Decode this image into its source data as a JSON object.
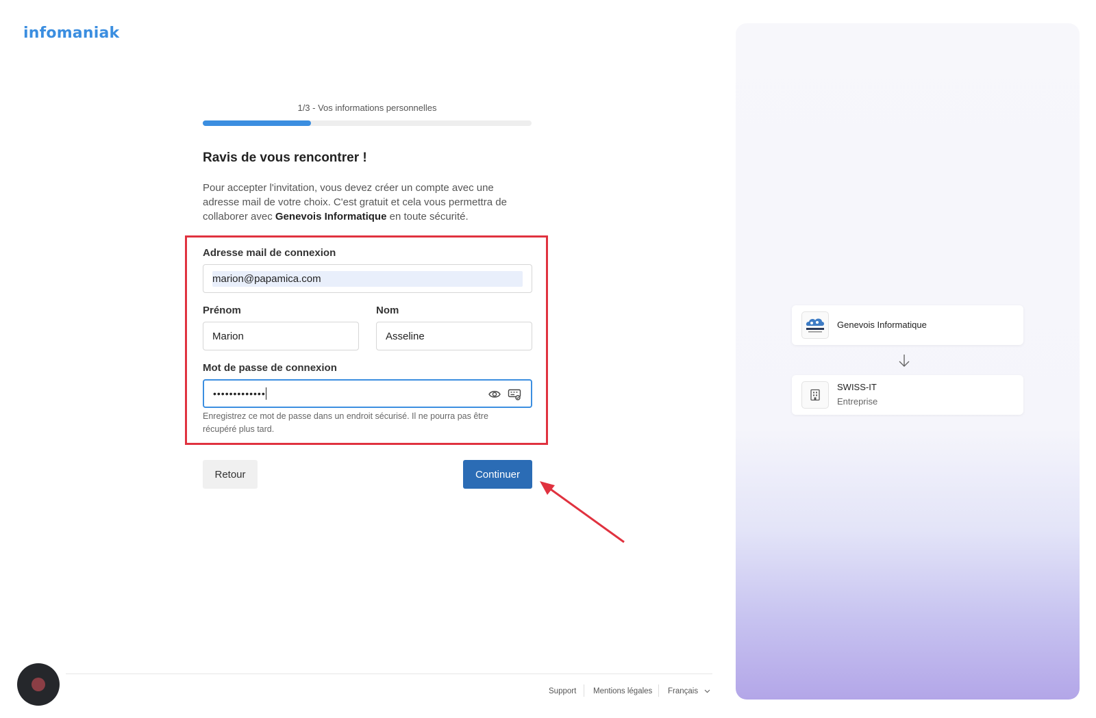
{
  "brand": {
    "logo_text": "infomaniak",
    "accent": "#3b8ee0"
  },
  "progress": {
    "step_label": "1/3 - Vos informations personnelles",
    "value": 0.33
  },
  "heading": "Ravis de vous rencontrer !",
  "intro": {
    "before": "Pour accepter l'invitation, vous devez créer un compte avec une adresse mail de votre choix. C'est gratuit et cela vous permettra de collaborer avec ",
    "org": "Genevois Informatique",
    "after": " en toute sécurité."
  },
  "form": {
    "email_label": "Adresse mail de connexion",
    "email_value": "marion@papamica.com",
    "firstname_label": "Prénom",
    "firstname_value": "Marion",
    "lastname_label": "Nom",
    "lastname_value": "Asseline",
    "password_label": "Mot de passe de connexion",
    "password_value": "•••••••••••••",
    "password_helper": "Enregistrez ce mot de passe dans un endroit sécurisé. Il ne pourra pas être récupéré plus tard."
  },
  "buttons": {
    "back": "Retour",
    "next": "Continuer",
    "next_color": "#2b6cb5"
  },
  "annotation": {
    "box_color": "#e0323f"
  },
  "footer": {
    "support": "Support",
    "legal": "Mentions légales",
    "language": "Français"
  },
  "sidebar": {
    "org_from": {
      "name": "Genevois Informatique",
      "logo_text": "GENEVOIS"
    },
    "org_to": {
      "name": "SWISS-IT",
      "type": "Entreprise"
    }
  }
}
